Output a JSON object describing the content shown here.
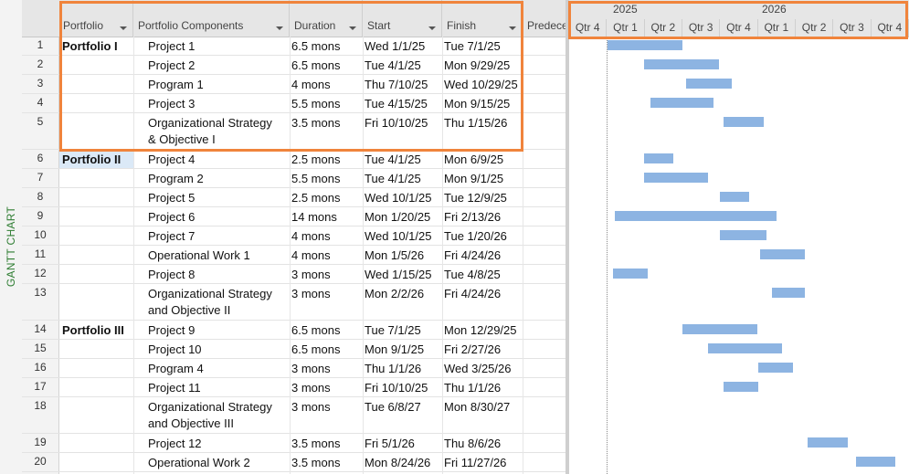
{
  "side_label": "GANTT CHART",
  "columns": [
    {
      "key": "portfolio",
      "label": "Portfolio"
    },
    {
      "key": "component",
      "label": "Portfolio Components"
    },
    {
      "key": "duration",
      "label": "Duration"
    },
    {
      "key": "start",
      "label": "Start"
    },
    {
      "key": "finish",
      "label": "Finish"
    },
    {
      "key": "pred",
      "label": "Predece"
    }
  ],
  "timeline": {
    "years": [
      "2025",
      "2026"
    ],
    "quarters": [
      "Qtr 4",
      "Qtr 1",
      "Qtr 2",
      "Qtr 3",
      "Qtr 4",
      "Qtr 1",
      "Qtr 2",
      "Qtr 3",
      "Qtr 4"
    ],
    "range": [
      "2024-10-01",
      "2026-12-31"
    ]
  },
  "rows": [
    {
      "num": "1",
      "portfolio": "Portfolio I",
      "component": "Project 1",
      "component2": "",
      "duration": "6.5 mons",
      "start": "Wed 1/1/25",
      "finish": "Tue 7/1/25",
      "bar": [
        "2025-01-01",
        "2025-07-01"
      ]
    },
    {
      "num": "2",
      "portfolio": "",
      "component": "Project 2",
      "component2": "",
      "duration": "6.5 mons",
      "start": "Tue 4/1/25",
      "finish": "Mon 9/29/25",
      "bar": [
        "2025-04-01",
        "2025-09-29"
      ]
    },
    {
      "num": "3",
      "portfolio": "",
      "component": "Program 1",
      "component2": "",
      "duration": "4 mons",
      "start": "Thu 7/10/25",
      "finish": "Wed 10/29/25",
      "bar": [
        "2025-07-10",
        "2025-10-29"
      ]
    },
    {
      "num": "4",
      "portfolio": "",
      "component": "Project 3",
      "component2": "",
      "duration": "5.5 mons",
      "start": "Tue 4/15/25",
      "finish": "Mon 9/15/25",
      "bar": [
        "2025-04-15",
        "2025-09-15"
      ]
    },
    {
      "num": "5",
      "portfolio": "",
      "component": "Organizational Strategy",
      "component2": "& Objective I",
      "duration": "3.5 mons",
      "start": "Fri 10/10/25",
      "finish": "Thu 1/15/26",
      "bar": [
        "2025-10-10",
        "2026-01-15"
      ]
    },
    {
      "num": "6",
      "portfolio": "Portfolio II",
      "component": "Project 4",
      "component2": "",
      "duration": "2.5 mons",
      "start": "Tue 4/1/25",
      "finish": "Mon 6/9/25",
      "bar": [
        "2025-04-01",
        "2025-06-09"
      ]
    },
    {
      "num": "7",
      "portfolio": "",
      "component": "Program 2",
      "component2": "",
      "duration": "5.5 mons",
      "start": "Tue 4/1/25",
      "finish": "Mon 9/1/25",
      "bar": [
        "2025-04-01",
        "2025-09-01"
      ]
    },
    {
      "num": "8",
      "portfolio": "",
      "component": "Project 5",
      "component2": "",
      "duration": "2.5 mons",
      "start": "Wed 10/1/25",
      "finish": "Tue 12/9/25",
      "bar": [
        "2025-10-01",
        "2025-12-09"
      ]
    },
    {
      "num": "9",
      "portfolio": "",
      "component": "Project 6",
      "component2": "",
      "duration": "14 mons",
      "start": "Mon 1/20/25",
      "finish": "Fri 2/13/26",
      "bar": [
        "2025-01-20",
        "2026-02-13"
      ]
    },
    {
      "num": "10",
      "portfolio": "",
      "component": "Project 7",
      "component2": "",
      "duration": "4 mons",
      "start": "Wed 10/1/25",
      "finish": "Tue 1/20/26",
      "bar": [
        "2025-10-01",
        "2026-01-20"
      ]
    },
    {
      "num": "11",
      "portfolio": "",
      "component": "Operational Work 1",
      "component2": "",
      "duration": "4 mons",
      "start": "Mon 1/5/26",
      "finish": "Fri 4/24/26",
      "bar": [
        "2026-01-05",
        "2026-04-24"
      ]
    },
    {
      "num": "12",
      "portfolio": "",
      "component": "Project 8",
      "component2": "",
      "duration": "3 mons",
      "start": "Wed 1/15/25",
      "finish": "Tue 4/8/25",
      "bar": [
        "2025-01-15",
        "2025-04-08"
      ]
    },
    {
      "num": "13",
      "portfolio": "",
      "component": "Organizational Strategy",
      "component2": "and Objective II",
      "duration": "3 mons",
      "start": "Mon 2/2/26",
      "finish": "Fri 4/24/26",
      "bar": [
        "2026-02-02",
        "2026-04-24"
      ]
    },
    {
      "num": "14",
      "portfolio": "Portfolio III",
      "component": "Project 9",
      "component2": "",
      "duration": "6.5 mons",
      "start": "Tue 7/1/25",
      "finish": "Mon 12/29/25",
      "bar": [
        "2025-07-01",
        "2025-12-29"
      ]
    },
    {
      "num": "15",
      "portfolio": "",
      "component": "Project 10",
      "component2": "",
      "duration": "6.5 mons",
      "start": "Mon 9/1/25",
      "finish": "Fri 2/27/26",
      "bar": [
        "2025-09-01",
        "2026-02-27"
      ]
    },
    {
      "num": "16",
      "portfolio": "",
      "component": "Program 4",
      "component2": "",
      "duration": "3 mons",
      "start": "Thu 1/1/26",
      "finish": "Wed 3/25/26",
      "bar": [
        "2026-01-01",
        "2026-03-25"
      ]
    },
    {
      "num": "17",
      "portfolio": "",
      "component": "Project 11",
      "component2": "",
      "duration": "3 mons",
      "start": "Fri 10/10/25",
      "finish": "Thu 1/1/26",
      "bar": [
        "2025-10-10",
        "2026-01-01"
      ]
    },
    {
      "num": "18",
      "portfolio": "",
      "component": "Organizational Strategy",
      "component2": "and Objective III",
      "duration": "3 mons",
      "start": "Tue 6/8/27",
      "finish": "Mon 8/30/27",
      "bar": null
    },
    {
      "num": "19",
      "portfolio": "",
      "component": "Project 12",
      "component2": "",
      "duration": "3.5 mons",
      "start": "Fri 5/1/26",
      "finish": "Thu 8/6/26",
      "bar": [
        "2026-05-01",
        "2026-08-06"
      ]
    },
    {
      "num": "20",
      "portfolio": "",
      "component": "Operational Work 2",
      "component2": "",
      "duration": "3.5 mons",
      "start": "Mon 8/24/26",
      "finish": "Fri 11/27/26",
      "bar": [
        "2026-08-24",
        "2026-11-27"
      ]
    }
  ],
  "colors": {
    "bar": "#8db4e2",
    "highlight": "#f0843c",
    "side_label": "#2e7d32",
    "header_bg": "#e6e6e6"
  }
}
